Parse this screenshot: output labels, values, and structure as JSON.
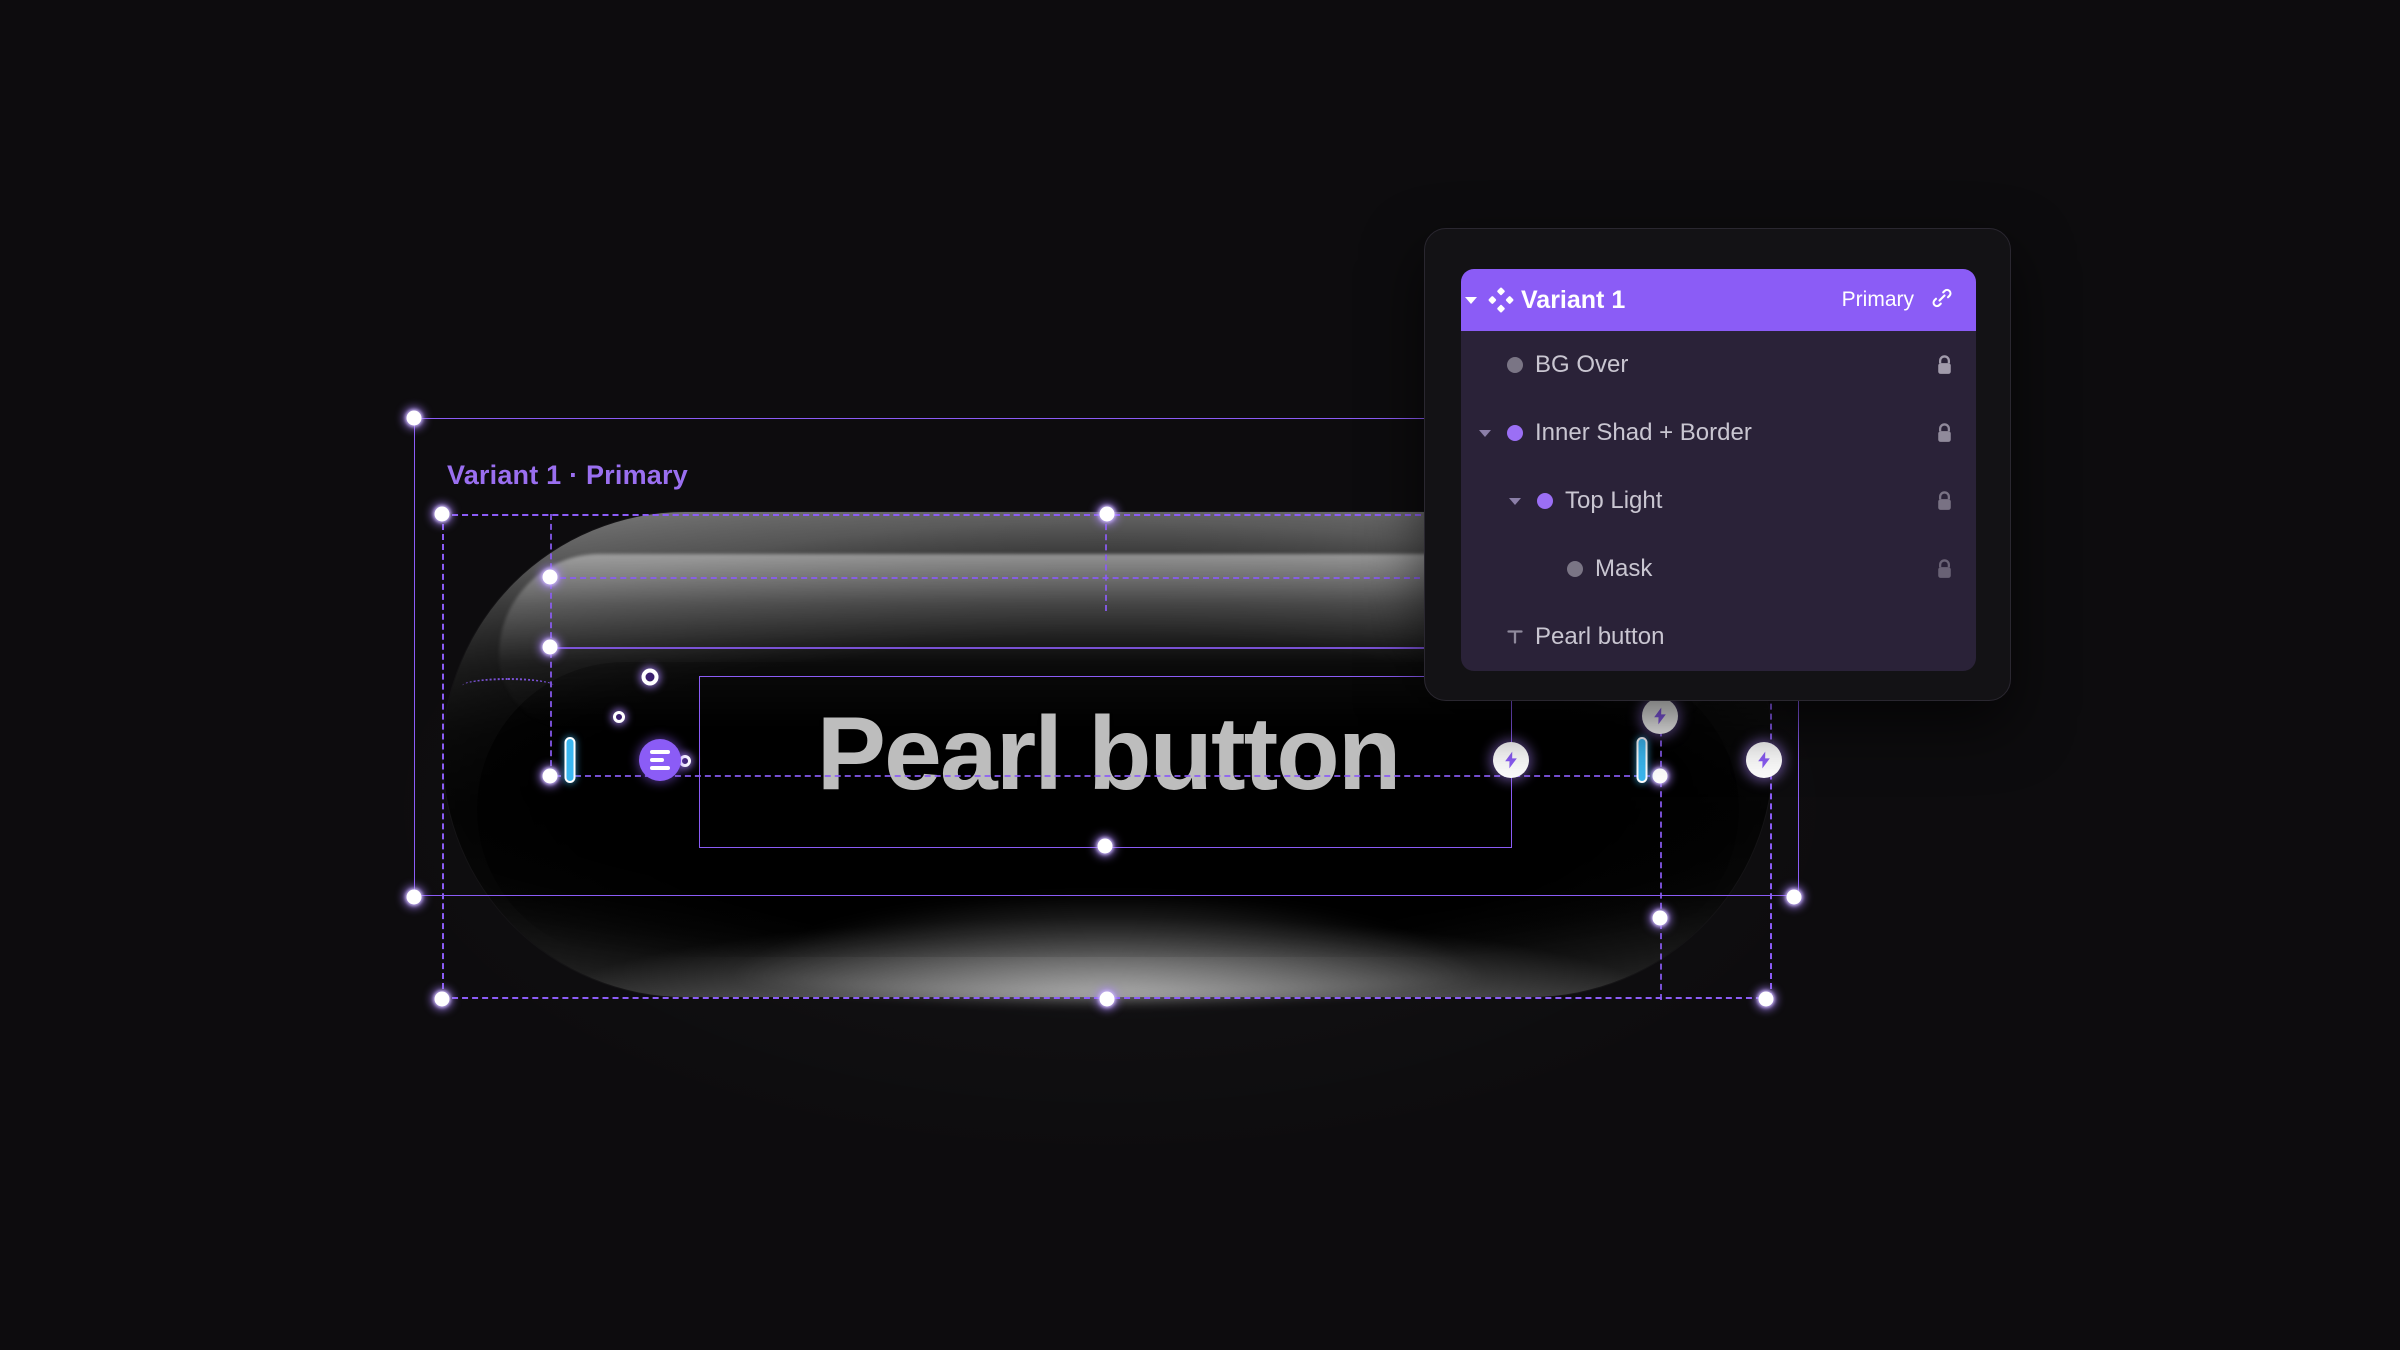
{
  "app": {
    "canvas_bg": "#0d0c0e",
    "accent": "#8b5cf6",
    "selection_color": "#8b5cf6"
  },
  "canvas": {
    "frame_label": "Variant 1 · Primary",
    "button": {
      "text": "Pearl button",
      "text_color": "#bdbdbd",
      "shape": "pill"
    },
    "badges": [
      {
        "name": "align-badge",
        "icon": "align-icon"
      },
      {
        "name": "autolayout-badge-left",
        "icon": "lightning-icon"
      },
      {
        "name": "autolayout-badge-top",
        "icon": "lightning-icon"
      },
      {
        "name": "autolayout-badge-right",
        "icon": "lightning-icon"
      }
    ]
  },
  "layers_panel": {
    "header": {
      "title": "Variant 1",
      "variant_property": "Primary",
      "icon": "component-icon",
      "link_icon": "link-icon",
      "expand_icon": "chevron-down-icon",
      "bg": "#8b5cf6"
    },
    "rows": [
      {
        "label": "BG Over",
        "indent": 1,
        "dot_color": "#7a7585",
        "has_toggle": false,
        "locked": true,
        "icon_type": "dot",
        "lock_opacity": 0.72
      },
      {
        "label": "Inner Shad + Border",
        "indent": 1,
        "dot_color": "#9b6ff5",
        "has_toggle": true,
        "locked": true,
        "icon_type": "dot",
        "lock_opacity": 0.62
      },
      {
        "label": "Top Light",
        "indent": 2,
        "dot_color": "#9b6ff5",
        "has_toggle": true,
        "locked": true,
        "icon_type": "dot",
        "lock_opacity": 0.48
      },
      {
        "label": "Mask",
        "indent": 3,
        "dot_color": "#7a7585",
        "has_toggle": false,
        "locked": true,
        "icon_type": "dot",
        "lock_opacity": 0.38
      },
      {
        "label": "Pearl button",
        "indent": 1,
        "dot_color": "#7a7585",
        "has_toggle": false,
        "locked": false,
        "icon_type": "text",
        "lock_opacity": 0
      }
    ]
  }
}
